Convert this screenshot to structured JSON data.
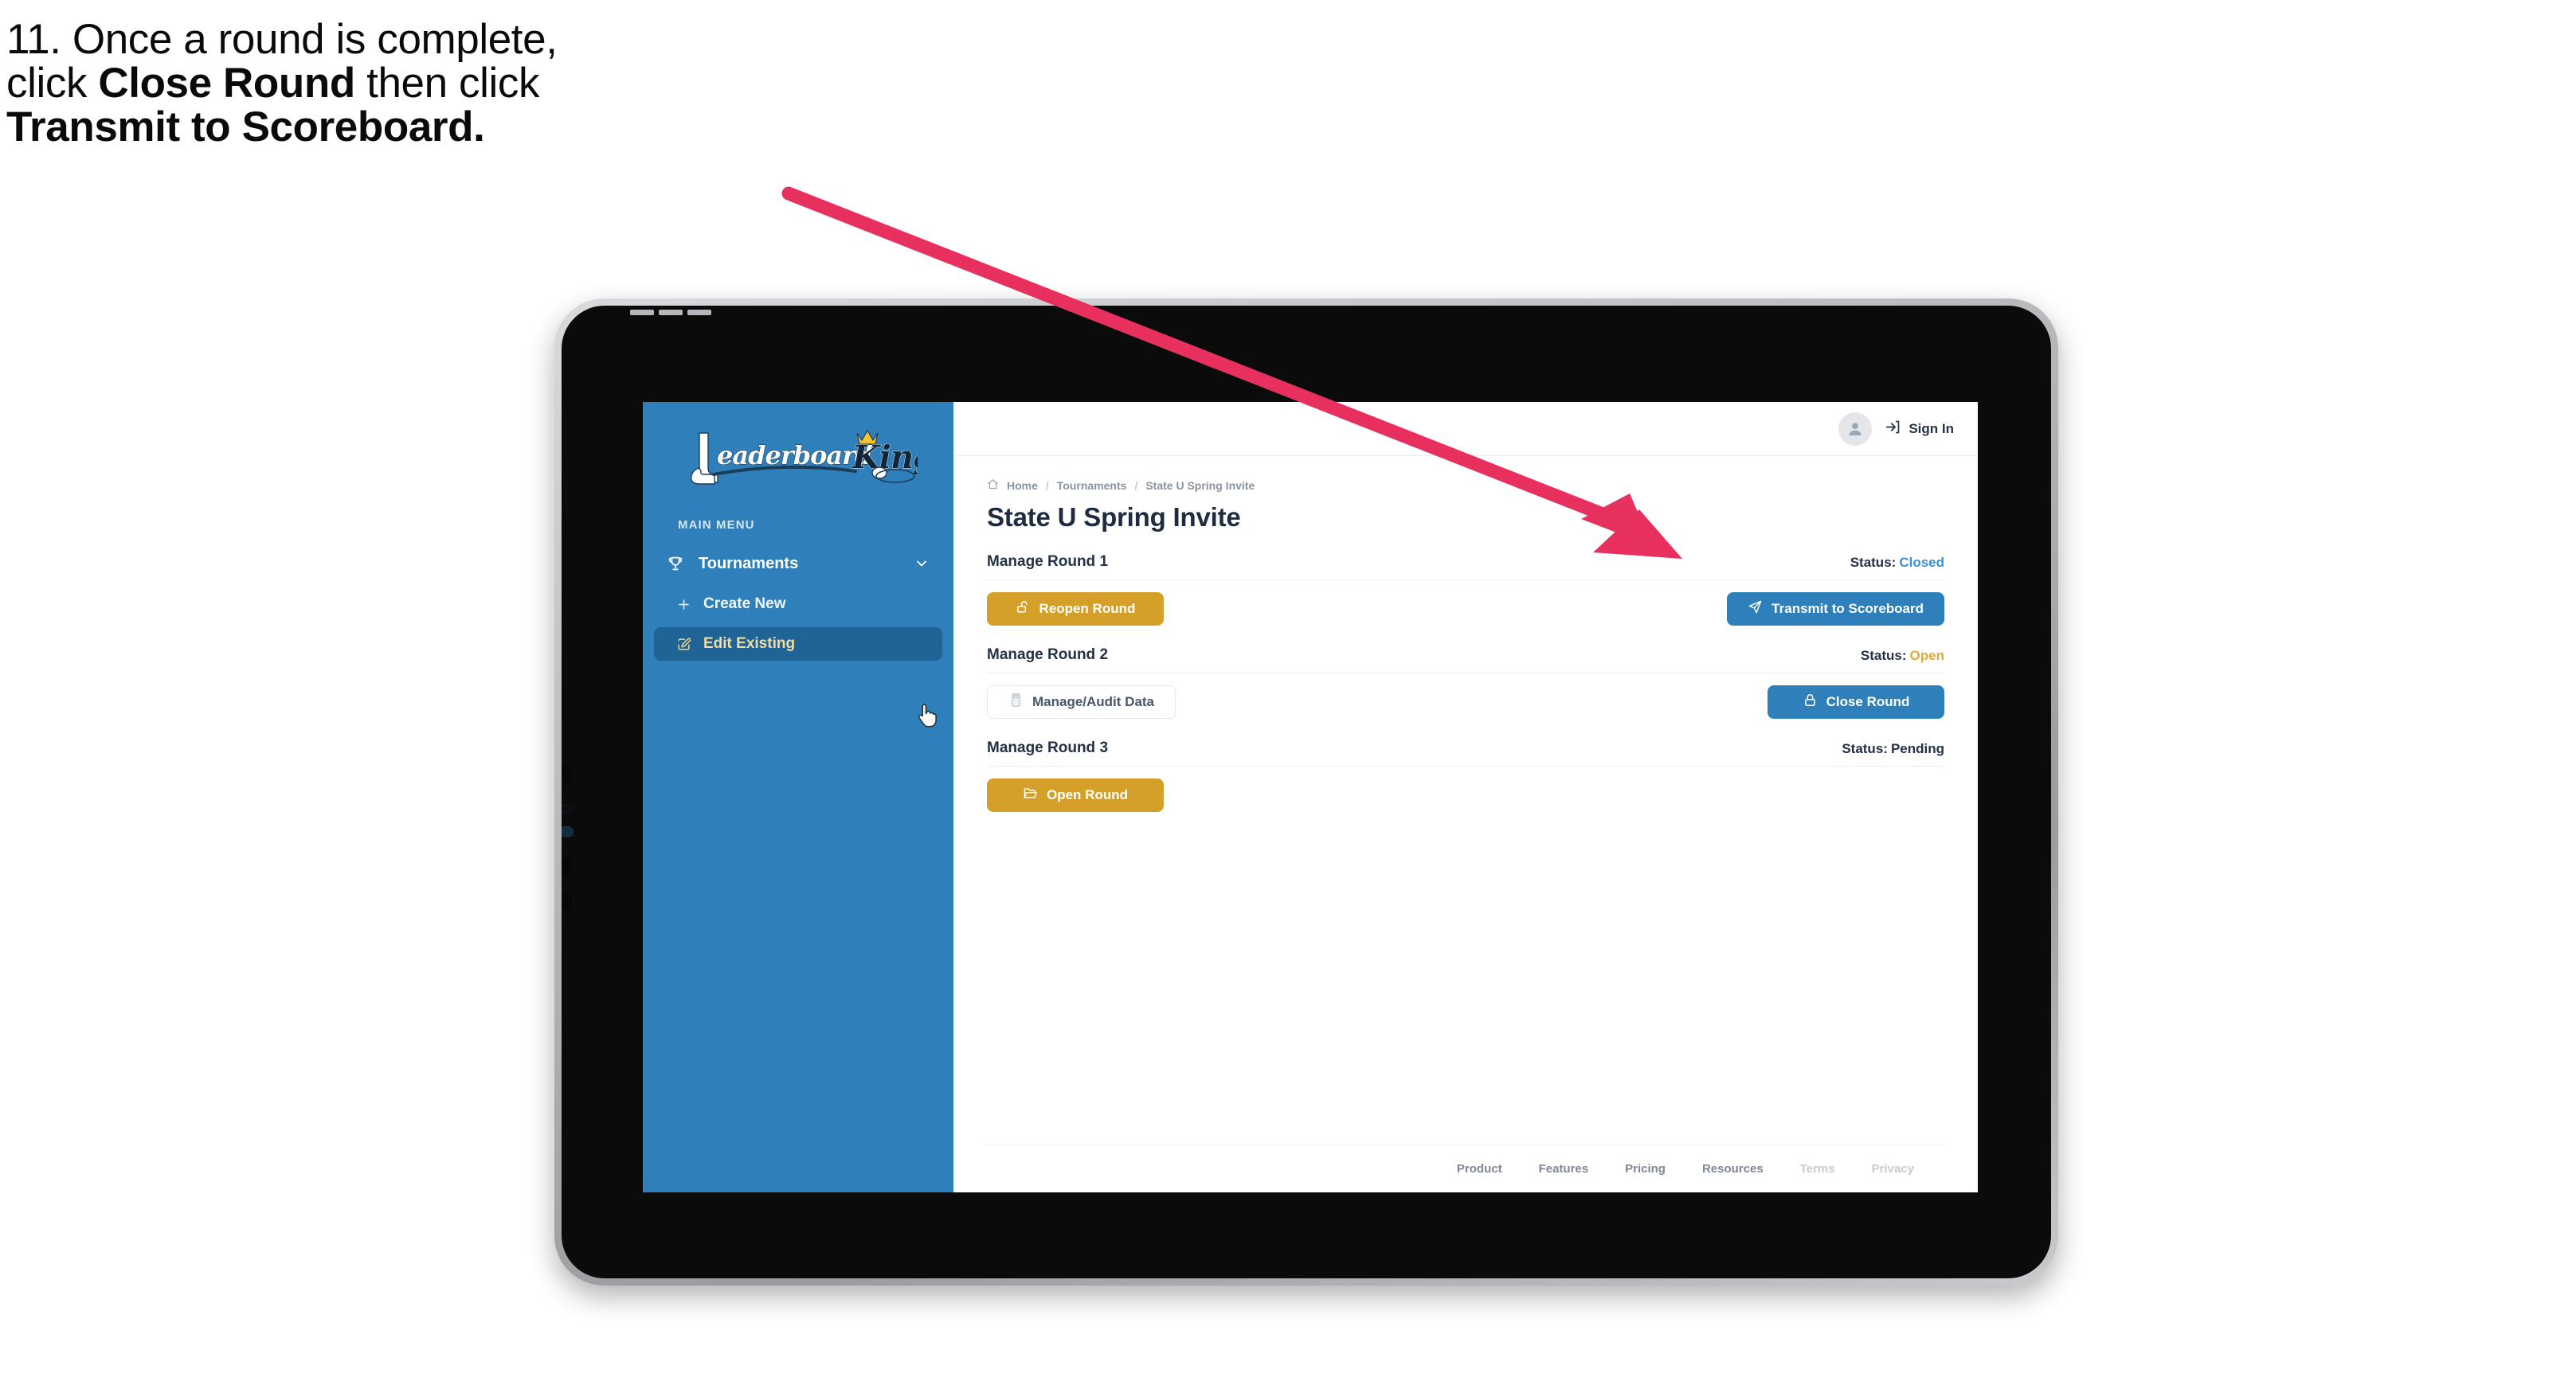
{
  "caption": {
    "line1_prefix": "11. Once a round is complete,",
    "line2_a": "click ",
    "line2_bold": "Close Round",
    "line2_b": " then click",
    "line3_bold": "Transmit to Scoreboard."
  },
  "annotation": {
    "arrow_color": "#E8305F",
    "arrow_points_to": "Transmit to Scoreboard"
  },
  "device": {
    "type": "tablet",
    "frame_color": "#b9babd",
    "bezel_color": "#0b0b0c"
  },
  "sidebar": {
    "brand": {
      "word_one": "Leaderboard",
      "word_two": "King",
      "icon": "golf-club-and-ball-logo"
    },
    "background_color": "#2F7FBA",
    "section_label": "MAIN MENU",
    "items": [
      {
        "label": "Tournaments",
        "icon": "trophy-icon",
        "expand_icon": "chevron-down-icon",
        "active": false
      },
      {
        "label": "Create New",
        "icon": "plus-icon",
        "active": false
      },
      {
        "label": "Edit Existing",
        "icon": "pencil-square-icon",
        "active": true
      }
    ],
    "cursor": "pointing-hand-cursor"
  },
  "topbar": {
    "avatar_icon": "user-avatar-icon",
    "signin_icon": "sign-in-arrow-icon",
    "signin_label": "Sign In"
  },
  "breadcrumb": {
    "home_icon": "home-icon",
    "items": [
      "Home",
      "Tournaments",
      "State U Spring Invite"
    ],
    "separator": "/"
  },
  "page": {
    "title": "State U Spring Invite"
  },
  "rounds": [
    {
      "title": "Manage Round 1",
      "status_label": "Status:",
      "status_value": "Closed",
      "status_color": "#3B8FD4",
      "left_button": {
        "label": "Reopen Round",
        "icon": "unlock-icon",
        "style": "gold"
      },
      "right_button": {
        "label": "Transmit to Scoreboard",
        "icon": "paper-plane-icon",
        "style": "blue"
      }
    },
    {
      "title": "Manage Round 2",
      "status_label": "Status:",
      "status_value": "Open",
      "status_color": "#E0A93C",
      "left_button": {
        "label": "Manage/Audit Data",
        "icon": "calculator-icon",
        "style": "ghost"
      },
      "right_button": {
        "label": "Close Round",
        "icon": "lock-icon",
        "style": "blue"
      }
    },
    {
      "title": "Manage Round 3",
      "status_label": "Status:",
      "status_value": "Pending",
      "status_color": "#243146",
      "left_button": {
        "label": "Open Round",
        "icon": "folder-open-icon",
        "style": "gold"
      },
      "right_button": null
    }
  ],
  "footer": {
    "links": [
      {
        "label": "Product",
        "dim": false
      },
      {
        "label": "Features",
        "dim": false
      },
      {
        "label": "Pricing",
        "dim": false
      },
      {
        "label": "Resources",
        "dim": false
      },
      {
        "label": "Terms",
        "dim": true
      },
      {
        "label": "Privacy",
        "dim": true
      }
    ]
  }
}
